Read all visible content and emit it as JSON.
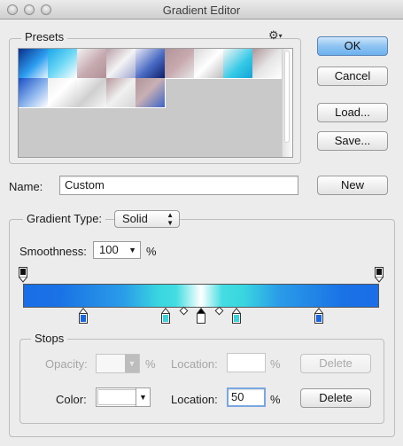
{
  "window": {
    "title": "Gradient Editor"
  },
  "presets": {
    "label": "Presets",
    "menu_icon": "gear-icon",
    "swatches": [
      {
        "name": "preset-1",
        "gradient": "linear-gradient(135deg,#0a2f8c,#2c9df0 55%,#e9f6ff)"
      },
      {
        "name": "preset-2",
        "gradient": "linear-gradient(135deg,#1aa6e8,#6ed8f5 50%,#ffffff)"
      },
      {
        "name": "preset-3",
        "gradient": "linear-gradient(135deg,#f2f2f2,#c6aab0 55%,#b09096)"
      },
      {
        "name": "preset-4",
        "gradient": "linear-gradient(135deg,#b8a0a8,#f4f4f4 50%,#9ea6d0)"
      },
      {
        "name": "preset-5",
        "gradient": "linear-gradient(135deg,#e8e8f4,#4a6bc4 55%,#0d1e6a)"
      },
      {
        "name": "preset-6",
        "gradient": "linear-gradient(135deg,#b19499,#c7a9ae 50%,#e6e6e6)"
      },
      {
        "name": "preset-7",
        "gradient": "linear-gradient(135deg,#d8d8d8,#ffffff 50%,#bdbdbd)"
      },
      {
        "name": "preset-8",
        "gradient": "linear-gradient(135deg,#f5f5f5,#32c8e6 60%,#17a4d6)"
      },
      {
        "name": "preset-9",
        "gradient": "linear-gradient(135deg,#b09497,#e5e5e5 50%,#ffffff)"
      },
      {
        "name": "preset-10",
        "gradient": "linear-gradient(135deg,#174fc6,#8fb6ee 55%,#ffffff)"
      },
      {
        "name": "preset-11",
        "gradient": "linear-gradient(135deg,#eeeeee,#ffffff 45%,#cfcfcf)"
      },
      {
        "name": "preset-12",
        "gradient": "linear-gradient(135deg,#ffffff,#cfcfcf 50%,#f6f6f6)"
      },
      {
        "name": "preset-13",
        "gradient": "linear-gradient(135deg,#b6989c,#f1f1f1 50%,#d5d5d5)"
      },
      {
        "name": "preset-14",
        "gradient": "linear-gradient(135deg,#b0959a,#c8b0b4 45%,#3b64c8)"
      }
    ]
  },
  "buttons": {
    "ok": "OK",
    "cancel": "Cancel",
    "load": "Load...",
    "save": "Save...",
    "new": "New"
  },
  "name": {
    "label": "Name:",
    "value": "Custom"
  },
  "gradient_type": {
    "label": "Gradient Type:",
    "value": "Solid"
  },
  "smoothness": {
    "label": "Smoothness:",
    "value": "100",
    "unit": "%"
  },
  "gradient_bar": "linear-gradient(90deg,#1a6ee6 0%,#1a72e6 10%,#2a9ce8 28%,#39d6e0 38%,#43dde2 43%,#ffffff 50%,#43dde2 56%,#39d6e0 62%,#2a9ce8 72%,#1a72e6 90%,#1a6ee6 100%)",
  "opacity_stops": [
    {
      "location": 0
    },
    {
      "location": 100
    }
  ],
  "color_stops": [
    {
      "location": 17,
      "color": "#1a66e0",
      "selected": false
    },
    {
      "location": 40,
      "color": "#36d4de",
      "selected": false
    },
    {
      "location": 50,
      "color": "#ffffff",
      "selected": true
    },
    {
      "location": 60,
      "color": "#36d4de",
      "selected": false
    },
    {
      "location": 83,
      "color": "#1a66e0",
      "selected": false
    }
  ],
  "midpoints": [
    {
      "location": 45
    },
    {
      "location": 55
    }
  ],
  "stops": {
    "label": "Stops",
    "opacity_label": "Opacity:",
    "opacity_value": "",
    "opacity_unit": "%",
    "opacity_location_label": "Location:",
    "opacity_location_value": "",
    "opacity_location_unit": "%",
    "opacity_delete": "Delete",
    "color_label": "Color:",
    "color_value": "#ffffff",
    "color_location_label": "Location:",
    "color_location_value": "50",
    "color_location_unit": "%",
    "color_delete": "Delete"
  }
}
